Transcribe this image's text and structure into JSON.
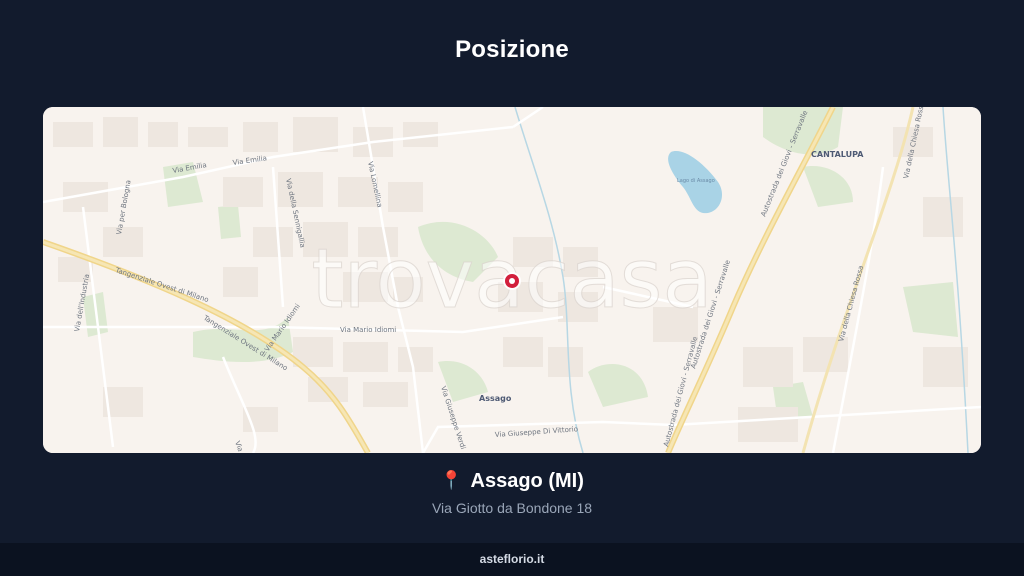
{
  "page": {
    "title": "Posizione",
    "footer_brand": "asteflorio.it"
  },
  "location": {
    "pin_icon": "📍",
    "city": "Assago (MI)",
    "address": "Via Giotto da Bondone 18"
  },
  "map": {
    "watermark": "trovacasa",
    "marker_icon": "map-marker-icon",
    "colors": {
      "land": "#f8f3ee",
      "park": "#dde9d2",
      "water": "#a9d3e6",
      "highway": "#f3dc9a",
      "marker": "#d21f3c"
    },
    "street_labels": {
      "via_emilia_1": "Via Emilia",
      "via_emilia_2": "Via Emilia",
      "via_lomellina": "Via Lomellina",
      "via_sennigallia": "Via della Sennigallia",
      "via_bologna": "Via per Bologna",
      "via_aufi": "Via dell'Industria",
      "tangenziale_1": "Tangenziale Ovest di Milano",
      "tangenziale_2": "Tangenziale Ovest di Milano",
      "via_mario_idiomi_1": "Via Mario Idiomi",
      "via_mario_idiomi_2": "Via Mario Idiomi",
      "via_giuseppe_verdi": "Via Giuseppe Verdi",
      "via_giuseppe_di_vittorio": "Via Giuseppe Di Vittorio",
      "autostrada_1": "Autostrada dei Giovi - Serravalle",
      "autostrada_2": "Autostrada dei Giovi - Serravalle",
      "autostrada_3": "Autostrada dei Giovi - Serravalle",
      "via_chiesa_rossa_1": "Via della Chiesa Rossa",
      "via_chiesa_rossa_2": "Via della Chiesa Rossa",
      "via_bottom_left": "Via dell'Ar"
    },
    "place_labels": {
      "assago": "Assago",
      "cantalupa": "CANTALUPA",
      "lago": "Lago di Assago"
    }
  }
}
